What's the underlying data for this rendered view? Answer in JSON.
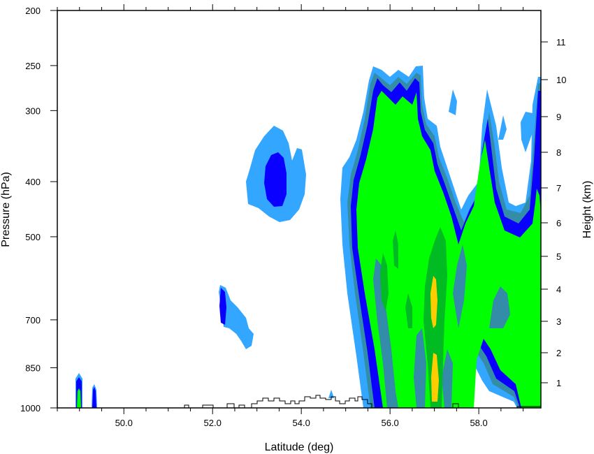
{
  "chart_data": {
    "type": "contour",
    "title": "",
    "xlabel": "Latitude (deg)",
    "ylabel": "Pressure (hPa)",
    "ylabel_right": "Height (km)",
    "xlim": [
      48.5,
      59.4
    ],
    "ylim_pressure": [
      1000,
      200
    ],
    "y_scale": "log",
    "x_ticks": [
      {
        "value": 50,
        "label": "50.0"
      },
      {
        "value": 52,
        "label": "52.0"
      },
      {
        "value": 54,
        "label": "54.0"
      },
      {
        "value": 56,
        "label": "56.0"
      },
      {
        "value": 58,
        "label": "58.0"
      }
    ],
    "y_ticks": [
      {
        "value": 1000,
        "label": "1000"
      },
      {
        "value": 850,
        "label": "850"
      },
      {
        "value": 700,
        "label": "700"
      },
      {
        "value": 500,
        "label": "500"
      },
      {
        "value": 400,
        "label": "400"
      },
      {
        "value": 300,
        "label": "300"
      },
      {
        "value": 250,
        "label": "250"
      },
      {
        "value": 200,
        "label": "200"
      }
    ],
    "y2_ticks": [
      "1",
      "2",
      "3",
      "4",
      "5",
      "6",
      "7",
      "8",
      "9",
      "10",
      "11"
    ],
    "levels_colors": [
      "#33a6ff",
      "#338ca8",
      "#0a00ff",
      "#00ff00",
      "#00bb22",
      "#ffcc00"
    ],
    "grid": false,
    "legend": "none"
  }
}
